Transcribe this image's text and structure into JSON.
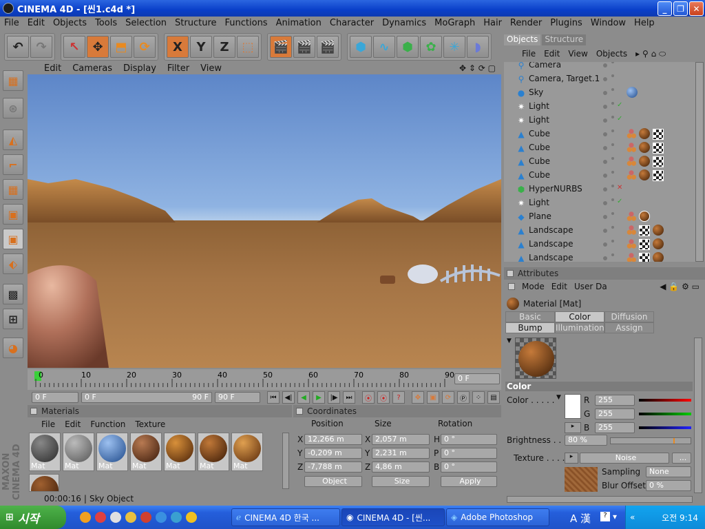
{
  "window": {
    "title": "CINEMA 4D - [씬1.c4d *]"
  },
  "menu": [
    "File",
    "Edit",
    "Objects",
    "Tools",
    "Selection",
    "Structure",
    "Functions",
    "Animation",
    "Character",
    "Dynamics",
    "MoGraph",
    "Hair",
    "Render",
    "Plugins",
    "Window",
    "Help"
  ],
  "toolbar_axes": [
    "X",
    "Y",
    "Z"
  ],
  "viewport_menu": [
    "Edit",
    "Cameras",
    "Display",
    "Filter",
    "View"
  ],
  "timeline": {
    "ticks": [
      "0",
      "10",
      "20",
      "30",
      "40",
      "50",
      "60",
      "70",
      "80",
      "90"
    ],
    "current_frame": "0 F",
    "start": "0 F",
    "range_start": "0 F",
    "range_end": "90 F",
    "end": "90 F"
  },
  "materials": {
    "title": "Materials",
    "menu": [
      "File",
      "Edit",
      "Function",
      "Texture"
    ],
    "items": [
      {
        "label": "Mat",
        "color": "#4a4a4a"
      },
      {
        "label": "Mat",
        "color": "#7d7d7d"
      },
      {
        "label": "Mat",
        "color": "#3d6fb5"
      },
      {
        "label": "Mat",
        "color": "#6a3a1a"
      },
      {
        "label": "Mat",
        "color": "#8a4a14"
      },
      {
        "label": "Mat",
        "color": "#7a3f14"
      },
      {
        "label": "Mat",
        "color": "#9a5a1e"
      }
    ]
  },
  "coordinates": {
    "title": "Coordinates",
    "headers": [
      "Position",
      "Size",
      "Rotation"
    ],
    "position": [
      {
        "axis": "X",
        "value": "12,266 m"
      },
      {
        "axis": "Y",
        "value": "-0,209 m"
      },
      {
        "axis": "Z",
        "value": "-7,788 m"
      }
    ],
    "size": [
      {
        "axis": "X",
        "value": "2,057 m"
      },
      {
        "axis": "Y",
        "value": "2,231 m"
      },
      {
        "axis": "Z",
        "value": "4,86 m"
      }
    ],
    "rotation": [
      {
        "axis": "H",
        "value": "0 °"
      },
      {
        "axis": "P",
        "value": "0 °"
      },
      {
        "axis": "B",
        "value": "0 °"
      }
    ],
    "mode": "Object",
    "size_mode": "Size",
    "apply_label": "Apply"
  },
  "status": {
    "time": "00:00:16",
    "text": "Sky Object"
  },
  "objects_panel": {
    "tabs": [
      "Objects",
      "Structure"
    ],
    "menu": [
      "File",
      "Edit",
      "View",
      "Objects"
    ],
    "rows": [
      {
        "name": "Camera",
        "icon": "camera-icon",
        "tags": []
      },
      {
        "name": "Camera, Target.1",
        "icon": "camera-icon",
        "tags": []
      },
      {
        "name": "Sky",
        "icon": "sky-icon",
        "tags": [
          "ball"
        ]
      },
      {
        "name": "Light",
        "icon": "light-icon",
        "tags": []
      },
      {
        "name": "Light",
        "icon": "light-icon",
        "tags": []
      },
      {
        "name": "Cube",
        "icon": "cube-icon",
        "tags": [
          "pin",
          "ball",
          "chk"
        ]
      },
      {
        "name": "Cube",
        "icon": "cube-icon",
        "tags": [
          "pin",
          "ball",
          "chk"
        ]
      },
      {
        "name": "Cube",
        "icon": "cube-icon",
        "tags": [
          "pin",
          "ball",
          "chk"
        ]
      },
      {
        "name": "Cube",
        "icon": "cube-icon",
        "tags": [
          "pin",
          "ball",
          "chk"
        ]
      },
      {
        "name": "HyperNURBS",
        "icon": "hypernurbs-icon",
        "tags": []
      },
      {
        "name": "Light",
        "icon": "light-icon",
        "tags": []
      },
      {
        "name": "Plane",
        "icon": "plane-icon",
        "tags": [
          "pin",
          "ball"
        ]
      },
      {
        "name": "Landscape",
        "icon": "landscape-icon",
        "tags": [
          "pin",
          "chk",
          "ball"
        ]
      },
      {
        "name": "Landscape",
        "icon": "landscape-icon",
        "tags": [
          "pin",
          "chk",
          "ball"
        ]
      },
      {
        "name": "Landscape",
        "icon": "landscape-icon",
        "tags": [
          "pin",
          "chk",
          "ball"
        ]
      }
    ]
  },
  "attributes": {
    "title": "Attributes",
    "menu": [
      "Mode",
      "Edit",
      "User Da"
    ],
    "material_name": "Material [Mat]",
    "tabs": [
      [
        "Basic",
        "Color",
        "Diffusion"
      ],
      [
        "Bump",
        "Illumination",
        "Assign"
      ]
    ],
    "section": "Color",
    "color_label": "Color . . . . .",
    "r": "255",
    "g": "255",
    "b": "255",
    "r_label": "R",
    "g_label": "G",
    "b_label": "B",
    "brightness_label": "Brightness . . .",
    "brightness": "80 %",
    "brightness_level": 0.8,
    "texture_label": "Texture . . . .",
    "texture_value": "Noise",
    "more": "...",
    "sampling_label": "Sampling",
    "sampling_value": "None",
    "blur_label": "Blur Offset",
    "blur_value": "0 %"
  },
  "taskbar": {
    "start": "시작",
    "tasks": [
      "CINEMA 4D 한국 ...",
      "CINEMA 4D - [씬...",
      "Adobe Photoshop"
    ],
    "ime": "A 漢",
    "clock": "오전 9:14"
  },
  "colors": {
    "accent": "#d87a3a",
    "sky_top": "#5d86c8",
    "ground": "#a47445"
  }
}
